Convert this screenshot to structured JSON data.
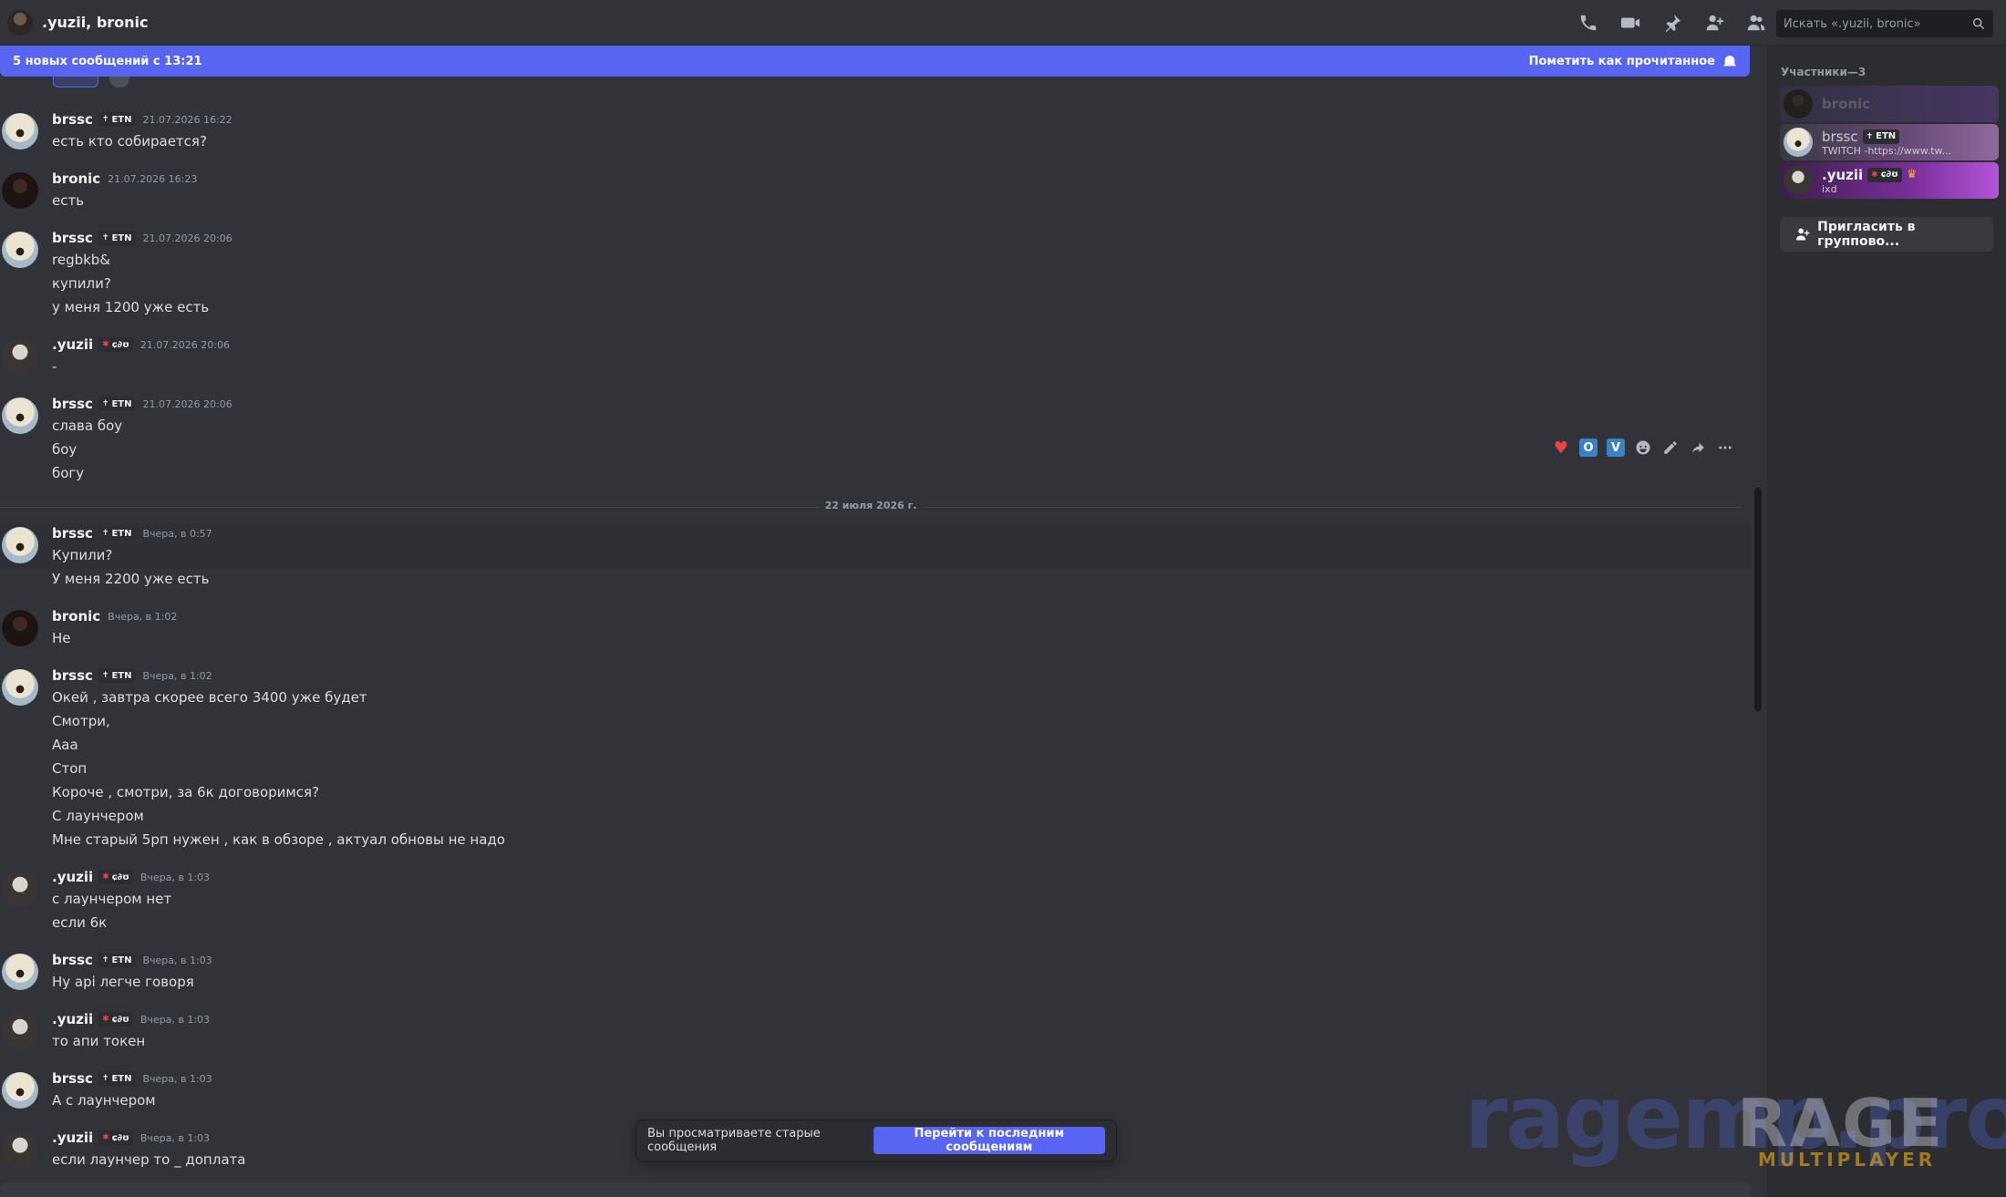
{
  "header": {
    "title": ".yuzii, bronic",
    "search_placeholder": "Искать «.yuzii, bronic»"
  },
  "new_bar": {
    "text": "5 новых сообщений с 13:21",
    "mark_read": "Пометить как прочитанное"
  },
  "messages": [
    {
      "user": "brssc",
      "tag": "ETN",
      "time": "21.07.2026 16:22",
      "lines": [
        "есть кто собирается?"
      ]
    },
    {
      "user": "bronic",
      "tag": "",
      "time": "21.07.2026 16:23",
      "lines": [
        "есть"
      ]
    },
    {
      "user": "brssc",
      "tag": "ETN",
      "time": "21.07.2026 20:06",
      "lines": [
        "regbkb&",
        "купили?",
        "у меня 1200 уже есть"
      ]
    },
    {
      "user": ".yuzii",
      "tag": "ɕ∂ʊ",
      "time": "21.07.2026 20:06",
      "lines": [
        "-"
      ]
    },
    {
      "user": "brssc",
      "tag": "ETN",
      "time": "21.07.2026 20:06",
      "lines": [
        "слава боу",
        "боу",
        "богу"
      ]
    },
    {
      "user": "brssc",
      "tag": "ETN",
      "time": "Вчера, в 0:57",
      "lines": [
        "Купили?",
        "У меня 2200 уже есть"
      ]
    },
    {
      "user": "bronic",
      "tag": "",
      "time": "Вчера, в 1:02",
      "lines": [
        "Не"
      ]
    },
    {
      "user": "brssc",
      "tag": "ETN",
      "time": "Вчера, в 1:02",
      "lines": [
        "Окей , завтра скорее всего 3400 уже будет",
        "Смотри,",
        "Ааа",
        "Стоп",
        "Короче , смотри, за 6к договоримся?",
        "С лаунчером",
        "Мне старый 5рп нужен , как в обзоре , актуал обновы не надо"
      ]
    },
    {
      "user": ".yuzii",
      "tag": "ɕ∂ʊ",
      "time": "Вчера, в 1:03",
      "lines": [
        "с лаунчером нет",
        "если 6к"
      ]
    },
    {
      "user": "brssc",
      "tag": "ETN",
      "time": "Вчера, в 1:03",
      "lines": [
        "Ну api легче говоря"
      ]
    },
    {
      "user": ".yuzii",
      "tag": "ɕ∂ʊ",
      "time": "Вчера, в 1:03",
      "lines": [
        "то апи токен"
      ]
    },
    {
      "user": "brssc",
      "tag": "ETN",
      "time": "Вчера, в 1:03",
      "lines": [
        "А с лаунчером"
      ]
    },
    {
      "user": ".yuzii",
      "tag": "ɕ∂ʊ",
      "time": "Вчера, в 1:03",
      "lines": [
        "если лаунчер то _ доплата"
      ]
    }
  ],
  "date_divider": "22 июля 2026 г.",
  "old_bar": {
    "text": "Вы просматриваете старые сообщения",
    "button": "Перейти к последним сообщениям"
  },
  "members": {
    "heading": "Участники—3",
    "list": [
      {
        "name": "bronic",
        "tag": "",
        "status": ""
      },
      {
        "name": "brssc",
        "tag": "ETN",
        "status": "TWITCH -https://www.tw..."
      },
      {
        "name": ".yuzii",
        "tag": "ɕ∂ʊ",
        "status": "ixd"
      }
    ],
    "invite": "Пригласить в группово..."
  },
  "watermark": {
    "site": "ragemp.pro",
    "brand": "RAGE",
    "sub": "MULTIPLAYER"
  },
  "colors": {
    "accent": "#5865f2",
    "bg": "#313338",
    "panel": "#2b2d31"
  }
}
